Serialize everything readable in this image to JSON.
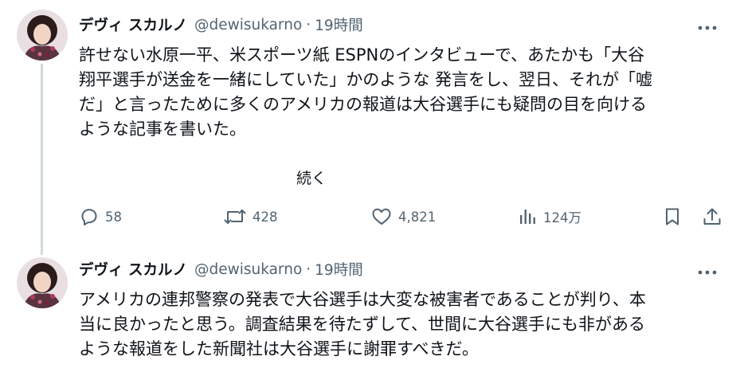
{
  "tweets": [
    {
      "author_name": "デヴィ スカルノ",
      "handle": "@dewisukarno",
      "separator": "·",
      "time": "19時間",
      "text_lines": [
        "許せない水原一平、米スポーツ紙 ESPNのインタビューで、あたかも「大谷",
        "翔平選手が送金を一緒にしていた」かのような 発言をし、翌日、それが「嘘",
        "だ」と言ったために多くのアメリカの報道は大谷選手にも疑問の目を向ける",
        "ような記事を書いた。"
      ],
      "continue_label": "続く",
      "stats": {
        "replies": "58",
        "retweets": "428",
        "likes": "4,821",
        "views": "124万"
      }
    },
    {
      "author_name": "デヴィ スカルノ",
      "handle": "@dewisukarno",
      "separator": "·",
      "time": "19時間",
      "text_lines": [
        "アメリカの連邦警察の発表で大谷選手は大変な被害者であることが判り、本",
        "当に良かったと思う。調査結果を待たずして、世間に大谷選手にも非がある",
        "ような報道をした新聞社は大谷選手に謝罪すべきだ。"
      ]
    }
  ],
  "icons": {
    "reply": "reply-icon",
    "retweet": "retweet-icon",
    "like": "heart-icon",
    "views": "analytics-icon",
    "bookmark": "bookmark-icon",
    "share": "share-icon",
    "more": "more-icon"
  },
  "colors": {
    "text_primary": "#0f1419",
    "text_secondary": "#536471",
    "thread_line": "#cfd9de",
    "background": "#ffffff"
  }
}
